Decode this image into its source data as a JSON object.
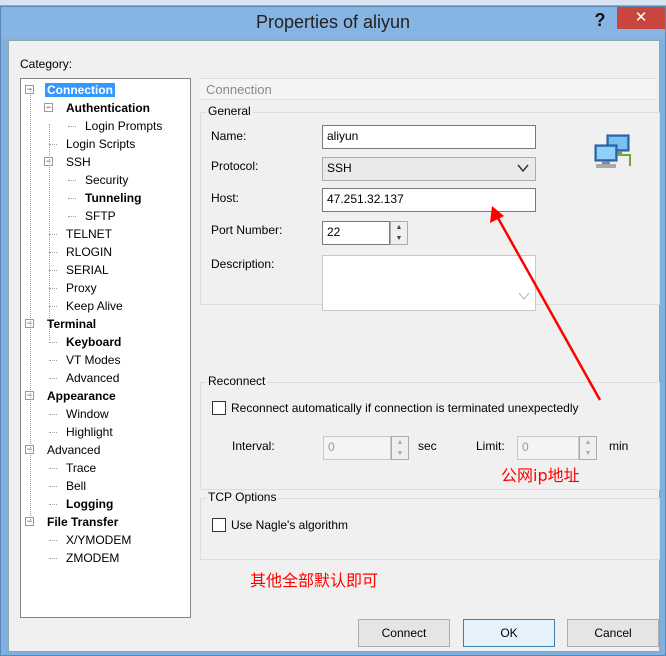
{
  "window": {
    "title": "Properties of aliyun",
    "help_label": "?",
    "close_label": "✕"
  },
  "category_label": "Category:",
  "tree": [
    {
      "id": "connection",
      "label": "Connection",
      "level": 0,
      "bold": true,
      "selected": true,
      "expander": "−"
    },
    {
      "id": "authentication",
      "label": "Authentication",
      "level": 1,
      "bold": true,
      "expander": "−"
    },
    {
      "id": "login-prompts",
      "label": "Login Prompts",
      "level": 2
    },
    {
      "id": "login-scripts",
      "label": "Login Scripts",
      "level": 1
    },
    {
      "id": "ssh",
      "label": "SSH",
      "level": 1,
      "expander": "−"
    },
    {
      "id": "security",
      "label": "Security",
      "level": 2
    },
    {
      "id": "tunneling",
      "label": "Tunneling",
      "level": 2,
      "bold": true
    },
    {
      "id": "sftp",
      "label": "SFTP",
      "level": 2
    },
    {
      "id": "telnet",
      "label": "TELNET",
      "level": 1
    },
    {
      "id": "rlogin",
      "label": "RLOGIN",
      "level": 1
    },
    {
      "id": "serial",
      "label": "SERIAL",
      "level": 1
    },
    {
      "id": "proxy",
      "label": "Proxy",
      "level": 1
    },
    {
      "id": "keep-alive",
      "label": "Keep Alive",
      "level": 1
    },
    {
      "id": "terminal",
      "label": "Terminal",
      "level": 0,
      "bold": true,
      "expander": "−"
    },
    {
      "id": "keyboard",
      "label": "Keyboard",
      "level": 1,
      "bold": true
    },
    {
      "id": "vt-modes",
      "label": "VT Modes",
      "level": 1
    },
    {
      "id": "advanced-terminal",
      "label": "Advanced",
      "level": 1
    },
    {
      "id": "appearance",
      "label": "Appearance",
      "level": 0,
      "bold": true,
      "expander": "−"
    },
    {
      "id": "window",
      "label": "Window",
      "level": 1
    },
    {
      "id": "highlight",
      "label": "Highlight",
      "level": 1
    },
    {
      "id": "advanced",
      "label": "Advanced",
      "level": 0,
      "expander": "−"
    },
    {
      "id": "trace",
      "label": "Trace",
      "level": 1
    },
    {
      "id": "bell",
      "label": "Bell",
      "level": 1
    },
    {
      "id": "logging",
      "label": "Logging",
      "level": 1,
      "bold": true
    },
    {
      "id": "file-transfer",
      "label": "File Transfer",
      "level": 0,
      "bold": true,
      "expander": "−"
    },
    {
      "id": "xymodem",
      "label": "X/YMODEM",
      "level": 1
    },
    {
      "id": "zmodem",
      "label": "ZMODEM",
      "level": 1
    }
  ],
  "panel": {
    "header": "Connection",
    "general": {
      "title": "General",
      "name_label": "Name:",
      "name_value": "aliyun",
      "protocol_label": "Protocol:",
      "protocol_value": "SSH",
      "host_label": "Host:",
      "host_value": "47.251.32.137",
      "port_label": "Port Number:",
      "port_value": "22",
      "description_label": "Description:",
      "description_value": ""
    },
    "reconnect": {
      "title": "Reconnect",
      "checkbox_label": "Reconnect automatically if connection is terminated unexpectedly",
      "interval_label": "Interval:",
      "interval_value": "0",
      "interval_unit": "sec",
      "limit_label": "Limit:",
      "limit_value": "0",
      "limit_unit": "min"
    },
    "tcp": {
      "title": "TCP Options",
      "nagle_label": "Use Nagle's algorithm"
    }
  },
  "buttons": {
    "connect": "Connect",
    "ok": "OK",
    "cancel": "Cancel"
  },
  "annotations": {
    "ip_note": "公网ip地址",
    "defaults_note": "其他全部默认即可",
    "color": "#ff0000"
  },
  "icons": {
    "network": "network-computers-icon"
  }
}
